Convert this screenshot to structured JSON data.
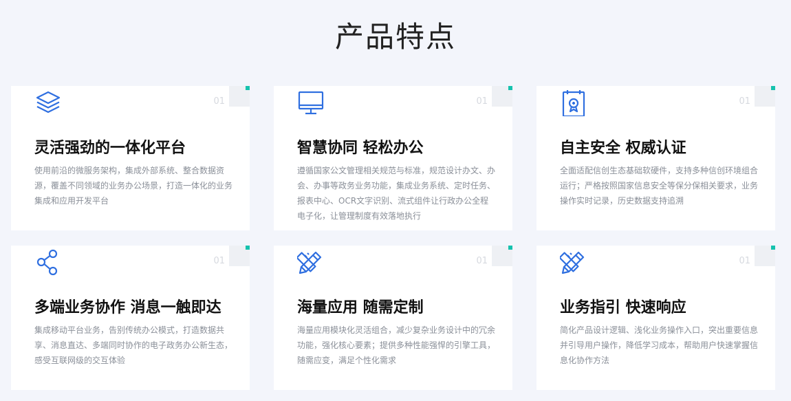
{
  "page_title": "产品特点",
  "colors": {
    "accent": "#2f6fe0",
    "corner_mark": "#16c2ae",
    "background": "#f3f5fb"
  },
  "cards": [
    {
      "icon": "layers-icon",
      "number": "01",
      "title": "灵活强劲的一体化平台",
      "desc": "使用前沿的微服务架构，集成外部系统、整合数据资源，覆盖不同领域的业务办公场景，打造一体化的业务集成和应用开发平台"
    },
    {
      "icon": "monitor-icon",
      "number": "01",
      "title": "智慧协同 轻松办公",
      "desc": "遵循国家公文管理相关规范与标准，规范设计办文、办会、办事等政务业务功能，集成业务系统、定时任务、报表中心、OCR文字识别、流式组件让行政办公全程电子化，让管理制度有效落地执行"
    },
    {
      "icon": "certificate-icon",
      "number": "01",
      "title": "自主安全 权威认证",
      "desc": "全面适配信创生态基础软硬件，支持多种信创环境组合运行；严格按照国家信息安全等保分保相关要求，业务操作实时记录，历史数据支持追溯"
    },
    {
      "icon": "share-icon",
      "number": "01",
      "title": "多端业务协作 消息一触即达",
      "desc": "集成移动平台业务，告别传统办公模式，打造数据共享、消息直达、多端同时协作的电子政务办公新生态，感受互联网级的交互体验"
    },
    {
      "icon": "pencil-ruler-icon",
      "number": "01",
      "title": "海量应用 随需定制",
      "desc": "海量应用模块化灵活组合，减少复杂业务设计中的冗余功能，强化核心要素；提供多种性能强悍的引擎工具，随需应变，满足个性化需求"
    },
    {
      "icon": "pencil-ruler-icon",
      "number": "01",
      "title": "业务指引 快速响应",
      "desc": "简化产品设计逻辑、浅化业务操作入口，突出重要信息并引导用户操作，降低学习成本，帮助用户快速掌握信息化协作方法"
    }
  ]
}
